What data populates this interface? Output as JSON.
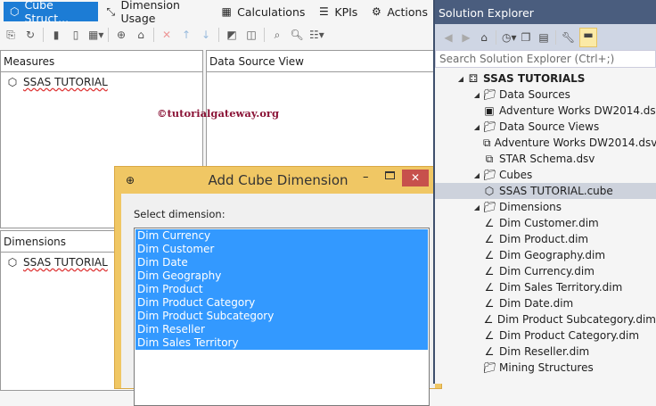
{
  "tabs": [
    {
      "label": "Cube Struct...",
      "icon": "cube-structure-icon"
    },
    {
      "label": "Dimension Usage",
      "icon": "dimension-usage-icon"
    },
    {
      "label": "Calculations",
      "icon": "calculations-icon"
    },
    {
      "label": "KPIs",
      "icon": "kpi-icon"
    },
    {
      "label": "Actions",
      "icon": "actions-icon"
    }
  ],
  "panels": {
    "measures": {
      "title": "Measures",
      "item": "SSAS TUTORIAL"
    },
    "dsv": {
      "title": "Data Source View"
    },
    "dimensions": {
      "title": "Dimensions",
      "item": "SSAS TUTORIAL"
    }
  },
  "watermark": "©tutorialgateway.org",
  "dialog": {
    "title": "Add Cube Dimension",
    "label": "Select dimension:",
    "items": [
      "Dim Currency",
      "Dim Customer",
      "Dim Date",
      "Dim Geography",
      "Dim Product",
      "Dim Product Category",
      "Dim Product Subcategory",
      "Dim Reseller",
      "Dim Sales Territory"
    ]
  },
  "solution_explorer": {
    "title": "Solution Explorer",
    "search_placeholder": "Search Solution Explorer (Ctrl+;)",
    "tree": [
      {
        "label": "SSAS TUTORIALS",
        "level": 0,
        "expanded": true,
        "icon": "solution-icon",
        "bold": true
      },
      {
        "label": "Data Sources",
        "level": 1,
        "expanded": true,
        "icon": "folder-icon"
      },
      {
        "label": "Adventure Works DW2014.ds",
        "level": 2,
        "icon": "datasource-icon"
      },
      {
        "label": "Data Source Views",
        "level": 1,
        "expanded": true,
        "icon": "folder-icon"
      },
      {
        "label": "Adventure Works DW2014.dsv",
        "level": 2,
        "icon": "dsv-icon"
      },
      {
        "label": "STAR Schema.dsv",
        "level": 2,
        "icon": "dsv-icon"
      },
      {
        "label": "Cubes",
        "level": 1,
        "expanded": true,
        "icon": "folder-icon"
      },
      {
        "label": "SSAS TUTORIAL.cube",
        "level": 2,
        "icon": "cube-icon",
        "selected": true
      },
      {
        "label": "Dimensions",
        "level": 1,
        "expanded": true,
        "icon": "folder-icon"
      },
      {
        "label": "Dim Customer.dim",
        "level": 2,
        "icon": "dimension-icon"
      },
      {
        "label": "Dim Product.dim",
        "level": 2,
        "icon": "dimension-icon"
      },
      {
        "label": "Dim Geography.dim",
        "level": 2,
        "icon": "dimension-icon"
      },
      {
        "label": "Dim Currency.dim",
        "level": 2,
        "icon": "dimension-icon"
      },
      {
        "label": "Dim Sales Territory.dim",
        "level": 2,
        "icon": "dimension-icon"
      },
      {
        "label": "Dim Date.dim",
        "level": 2,
        "icon": "dimension-icon"
      },
      {
        "label": "Dim Product Subcategory.dim",
        "level": 2,
        "icon": "dimension-icon"
      },
      {
        "label": "Dim Product Category.dim",
        "level": 2,
        "icon": "dimension-icon"
      },
      {
        "label": "Dim Reseller.dim",
        "level": 2,
        "icon": "dimension-icon"
      },
      {
        "label": "Mining Structures",
        "level": 1,
        "icon": "folder-icon"
      }
    ]
  }
}
